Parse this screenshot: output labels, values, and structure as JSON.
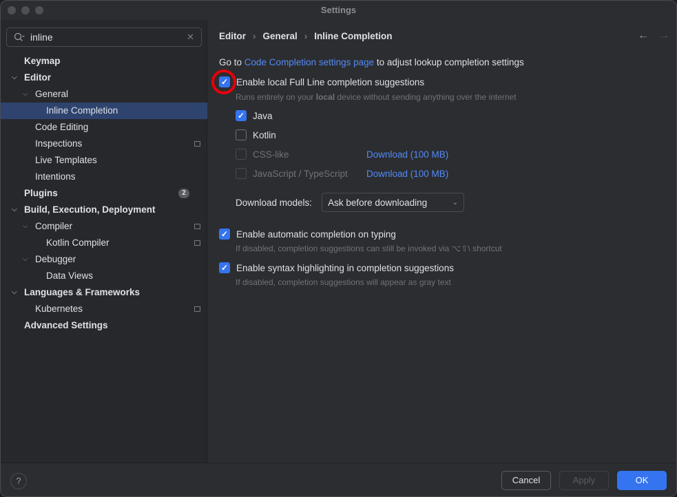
{
  "window": {
    "title": "Settings"
  },
  "search": {
    "value": "inline"
  },
  "tree": [
    {
      "label": "Keymap",
      "bold": true
    },
    {
      "label": "Editor",
      "bold": true,
      "chev": true
    },
    {
      "label": "General",
      "chev": true
    },
    {
      "label": "Inline Completion",
      "selected": true
    },
    {
      "label": "Code Editing"
    },
    {
      "label": "Inspections",
      "project": true
    },
    {
      "label": "Live Templates"
    },
    {
      "label": "Intentions"
    },
    {
      "label": "Plugins",
      "bold": true,
      "badge": "2"
    },
    {
      "label": "Build, Execution, Deployment",
      "bold": true,
      "chev": true
    },
    {
      "label": "Compiler",
      "chev": true,
      "project": true
    },
    {
      "label": "Kotlin Compiler",
      "project": true
    },
    {
      "label": "Debugger",
      "chev": true
    },
    {
      "label": "Data Views"
    },
    {
      "label": "Languages & Frameworks",
      "bold": true,
      "chev": true
    },
    {
      "label": "Kubernetes",
      "project": true
    },
    {
      "label": "Advanced Settings",
      "bold": true
    }
  ],
  "breadcrumb": [
    "Editor",
    "General",
    "Inline Completion"
  ],
  "main": {
    "goto_prefix": "Go to ",
    "goto_link": "Code Completion settings page",
    "goto_suffix": " to adjust lookup completion settings",
    "full_line": {
      "label": "Enable local Full Line completion suggestions",
      "hint_a": "Runs entirely on your ",
      "hint_b": "local",
      "hint_c": " device without sending anything over the internet"
    },
    "langs": [
      {
        "label": "Java",
        "state": "on"
      },
      {
        "label": "Kotlin",
        "state": "off"
      },
      {
        "label": "CSS-like",
        "state": "dis",
        "download": "Download (100 MB)"
      },
      {
        "label": "JavaScript / TypeScript",
        "state": "dis",
        "download": "Download (100 MB)"
      }
    ],
    "download_models_label": "Download models:",
    "download_models_value": "Ask before downloading",
    "auto": {
      "label": "Enable automatic completion on typing",
      "hint": "If disabled, completion suggestions can still be invoked via ⌥⇧\\ shortcut"
    },
    "syntax": {
      "label": "Enable syntax highlighting in completion suggestions",
      "hint": "If disabled, completion suggestions will appear as gray text"
    }
  },
  "footer": {
    "cancel": "Cancel",
    "apply": "Apply",
    "ok": "OK",
    "help": "?"
  }
}
